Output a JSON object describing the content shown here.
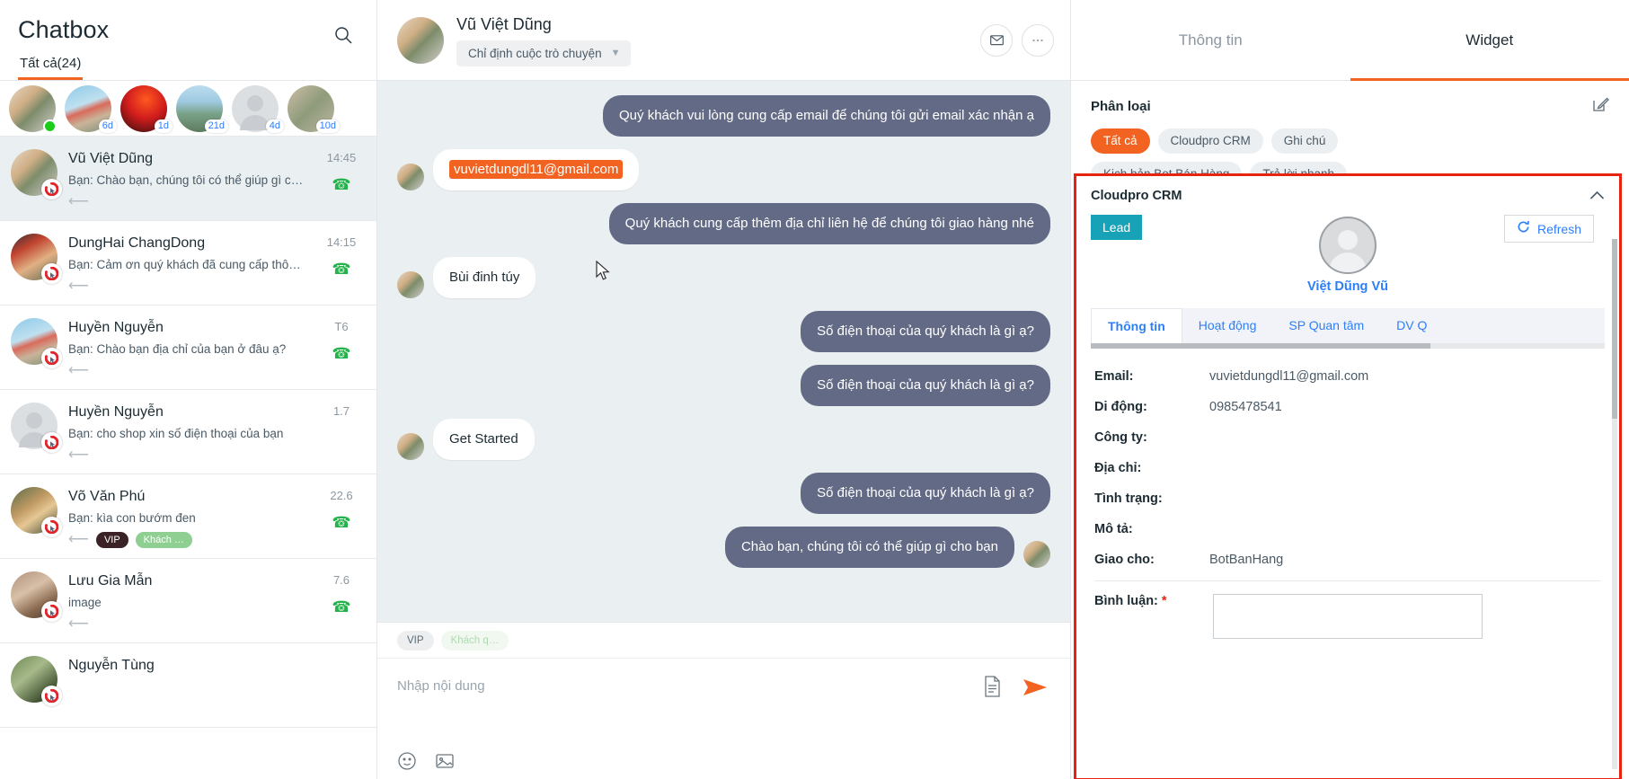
{
  "left": {
    "title": "Chatbox",
    "tab_all": "Tất cả(24)",
    "search_icon": "search-icon",
    "stories": [
      {
        "badge": "",
        "online": true,
        "img": "person1"
      },
      {
        "badge": "6d",
        "online": false,
        "img": "lighthouse"
      },
      {
        "badge": "1d",
        "online": false,
        "img": "red"
      },
      {
        "badge": "21d",
        "online": false,
        "img": "lake"
      },
      {
        "badge": "4d",
        "online": false,
        "img": "placeholder"
      },
      {
        "badge": "10d",
        "online": false,
        "img": "person6"
      }
    ],
    "conversations": [
      {
        "name": "Vũ Việt Dũng",
        "snippet": "Bạn: Chào bạn, chúng tôi có thể giúp gì ch…",
        "time": "14:45",
        "phone": true,
        "tags": [],
        "active": true,
        "img": "person1"
      },
      {
        "name": "DungHai ChangDong",
        "snippet": "Bạn: Cảm ơn quý khách đã cung cấp thông…",
        "time": "14:15",
        "phone": true,
        "tags": [],
        "active": false,
        "img": "kid"
      },
      {
        "name": "Huyền Nguyễn",
        "snippet": "Bạn: Chào bạn địa chỉ của bạn ở đâu ạ?",
        "time": "T6",
        "phone": true,
        "tags": [],
        "active": false,
        "img": "lighthouse"
      },
      {
        "name": "Huyền Nguyễn",
        "snippet": "Bạn: cho shop xin số điện thoại của bạn",
        "time": "1.7",
        "phone": false,
        "tags": [],
        "active": false,
        "img": "placeholder"
      },
      {
        "name": "Võ Văn Phú",
        "snippet": "Bạn: kìa con bướm đen",
        "time": "22.6",
        "phone": true,
        "tags": [
          "VIP",
          "Khách …"
        ],
        "active": false,
        "img": "phu"
      },
      {
        "name": "Lưu Gia Mẫn",
        "snippet": " image",
        "time": "7.6",
        "phone": true,
        "tags": [],
        "active": false,
        "img": "man"
      },
      {
        "name": "Nguyễn Tùng",
        "snippet": "",
        "time": "",
        "phone": false,
        "tags": [],
        "active": false,
        "img": "tung"
      }
    ]
  },
  "center": {
    "contact_name": "Vũ Việt Dũng",
    "assign_label": "Chỉ định cuộc trò chuyện",
    "mail_icon": "envelope-icon",
    "more_icon": "ellipsis-icon",
    "messages": [
      {
        "dir": "out",
        "text": "Quý khách vui lòng cung cấp email để chúng tôi gửi email xác nhận ạ",
        "avatar": false,
        "highlight": ""
      },
      {
        "dir": "in",
        "text": "",
        "avatar": true,
        "highlight": "vuvietdungdl11@gmail.com"
      },
      {
        "dir": "out",
        "text": "Quý khách cung cấp thêm địa chỉ liên hệ để chúng tôi giao hàng nhé",
        "avatar": false,
        "highlight": ""
      },
      {
        "dir": "in",
        "text": "Bùi đinh túy",
        "avatar": true,
        "highlight": ""
      },
      {
        "dir": "out",
        "text": "Số điện thoại của quý khách là gì ạ?",
        "avatar": false,
        "highlight": ""
      },
      {
        "dir": "out",
        "text": "Số điện thoại của quý khách là gì ạ?",
        "avatar": false,
        "highlight": ""
      },
      {
        "dir": "in",
        "text": "Get Started",
        "avatar": true,
        "highlight": ""
      },
      {
        "dir": "out",
        "text": "Số điện thoại của quý khách là gì ạ?",
        "avatar": false,
        "highlight": ""
      },
      {
        "dir": "out",
        "text": "Chào bạn, chúng tôi có thể giúp gì cho bạn",
        "avatar": true,
        "highlight": ""
      }
    ],
    "compose_tags": [
      "VIP",
      "Khách q…"
    ],
    "composer_placeholder": "Nhập nội dung",
    "composer_value": "",
    "attach_icon": "document-icon",
    "send_icon": "send-icon",
    "emoji_icon": "emoji-icon",
    "image_icon": "image-icon"
  },
  "right": {
    "tabs": [
      {
        "label": "Thông tin",
        "active": false
      },
      {
        "label": "Widget",
        "active": true
      }
    ],
    "section_title": "Phân loại",
    "edit_icon": "edit-icon",
    "chips": [
      {
        "label": "Tất cả",
        "active": true
      },
      {
        "label": "Cloudpro CRM",
        "active": false
      },
      {
        "label": "Ghi chú",
        "active": false
      },
      {
        "label": "Kịch bản Bot Bán Hàng",
        "active": false
      },
      {
        "label": "Trả lời nhanh",
        "active": false
      }
    ],
    "crm": {
      "card_title": "Cloudpro CRM",
      "collapse_icon": "chevron-up-icon",
      "lead_badge": "Lead",
      "refresh_label": "Refresh",
      "refresh_icon": "refresh-icon",
      "person_name": "Việt Dũng Vũ",
      "tabs": [
        {
          "label": "Thông tin",
          "active": true
        },
        {
          "label": "Hoạt động",
          "active": false
        },
        {
          "label": "SP Quan tâm",
          "active": false
        },
        {
          "label": "DV Q",
          "active": false
        }
      ],
      "fields": [
        {
          "label": "Email:",
          "value": "vuvietdungdl11@gmail.com"
        },
        {
          "label": "Di động:",
          "value": "0985478541"
        },
        {
          "label": "Công ty:",
          "value": ""
        },
        {
          "label": "Địa chỉ:",
          "value": ""
        },
        {
          "label": "Tình trạng:",
          "value": ""
        },
        {
          "label": "Mô tả:",
          "value": ""
        },
        {
          "label": "Giao cho:",
          "value": "BotBanHang"
        }
      ],
      "comment_label": "Bình luận:",
      "comment_required": "*",
      "comment_value": ""
    }
  },
  "colors": {
    "accent": "#f26322",
    "bubble_out": "#636a85",
    "lead": "#17a2b8",
    "link": "#2d7ff9",
    "highlight_red": "#e8230f",
    "online": "#19cd19",
    "phone_green": "#24b24b"
  }
}
